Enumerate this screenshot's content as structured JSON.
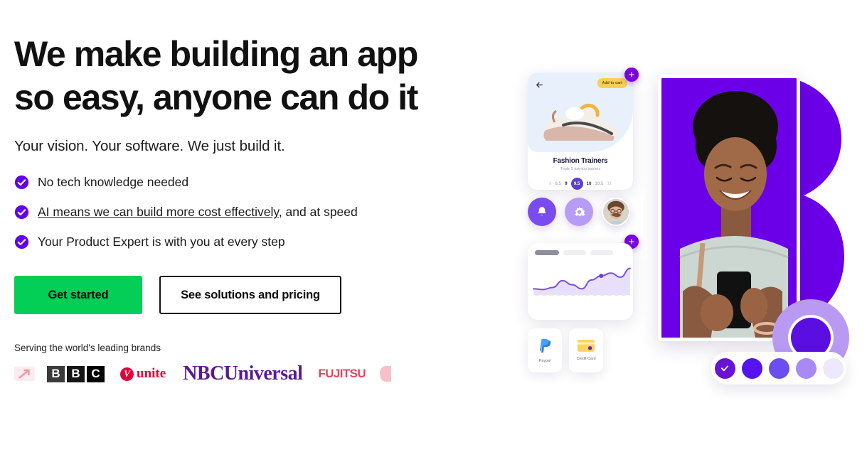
{
  "hero": {
    "headline": "We make building an app so easy, anyone can do it",
    "subhead": "Your vision. Your software. We just build it.",
    "bullets": [
      {
        "text": "No tech knowledge needed",
        "link": "",
        "suffix": ""
      },
      {
        "text": "",
        "link": "AI means we can build more cost effectively",
        "suffix": ", and at speed"
      },
      {
        "text": "Your Product Expert is with you at every step",
        "link": "",
        "suffix": ""
      }
    ],
    "primary_cta": "Get started",
    "secondary_cta": "See solutions and pricing",
    "brands_label": "Serving the world's leading brands",
    "brands": [
      {
        "name": "royal-mail",
        "label": ""
      },
      {
        "name": "bbc",
        "label": "BBC"
      },
      {
        "name": "unite",
        "label": "unite"
      },
      {
        "name": "nbcuniversal",
        "label": "NBCUniversal"
      },
      {
        "name": "fujitsu",
        "label": "FUJITSU"
      },
      {
        "name": "partial-logo",
        "label": ""
      }
    ],
    "bbc_letters": [
      "B",
      "B",
      "C"
    ],
    "unite_word": "unite",
    "nbc_text": "NBCUniversal",
    "fujitsu_text": "FUJITSU"
  },
  "art": {
    "shoe_card": {
      "back_icon": "arrow-left-icon",
      "add_to_cart": "Add to cart",
      "title": "Fashion Trainers",
      "subtitle": "Triple S low-top trainers",
      "sizes": [
        "8",
        "8.5",
        "9",
        "9.5",
        "10",
        "10.5",
        "11"
      ],
      "selected_size": "9.5"
    },
    "plus_badges": [
      "plus-badge-top",
      "plus-badge-chart"
    ],
    "plus_glyph": "+",
    "icons": [
      {
        "name": "bell-icon"
      },
      {
        "name": "gear-icon"
      },
      {
        "name": "avatar"
      }
    ],
    "chart_card": {
      "tabs_active_index": 0,
      "tab_count": 3
    },
    "payments": [
      {
        "name": "paypal",
        "label": "Paypal"
      },
      {
        "name": "credit-card",
        "label": "Credit Card"
      }
    ],
    "swatches": [
      {
        "color": "#6a13d6",
        "selected": true
      },
      {
        "color": "#5413ef"
      },
      {
        "color": "#6b4ef2"
      },
      {
        "color": "#a98af5"
      },
      {
        "color": "#eee8fc"
      }
    ]
  },
  "colors": {
    "green": "#03ce55",
    "purple": "#6200ee",
    "brand_purple": "#7a00e0",
    "nbc_purple": "#5b1a8f",
    "unite_red": "#e3003a",
    "fujitsu_red": "#e8445c",
    "yellow": "#fbcf51",
    "text": "#111111"
  },
  "chart_data": {
    "type": "area",
    "title": "",
    "x": [
      0,
      1,
      2,
      3,
      4,
      5,
      6,
      7,
      8,
      9,
      10
    ],
    "values": [
      18,
      16,
      22,
      42,
      30,
      18,
      44,
      56,
      64,
      52,
      78
    ],
    "xlabel": "",
    "ylabel": "",
    "ylim": [
      0,
      100
    ],
    "grid": false,
    "legend": "none",
    "marker_point": {
      "x": 7,
      "y": 56
    },
    "line_color": "#7b4fe0",
    "fill_color": "#e8e0fb"
  }
}
